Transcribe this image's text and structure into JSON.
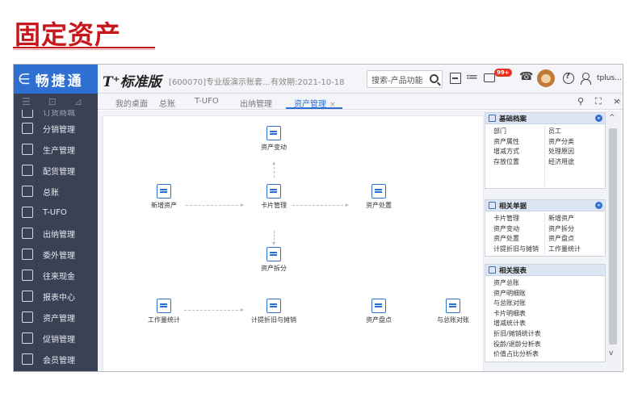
{
  "banner": {
    "title": "固定资产"
  },
  "app": {
    "logo_arrow": "∈",
    "logo_text": "畅捷通",
    "product_name": "T⁺标准版",
    "account_info": "[600070]专业版演示账套...",
    "expiry": "有效期:2021-10-18",
    "search_placeholder": "搜索-产品功能",
    "badge": "99+",
    "username": "tplus..."
  },
  "sidebar": {
    "toolbar_icons": [
      "menu-icon",
      "home-icon",
      "pin-icon"
    ],
    "items": [
      {
        "label": "订货商城",
        "icon": "shop-icon"
      },
      {
        "label": "分销管理",
        "icon": "network-icon"
      },
      {
        "label": "生产管理",
        "icon": "factory-icon"
      },
      {
        "label": "配货管理",
        "icon": "delivery-icon"
      },
      {
        "label": "总账",
        "icon": "ledger-icon"
      },
      {
        "label": "T-UFO",
        "icon": "ufo-icon"
      },
      {
        "label": "出纳管理",
        "icon": "cashier-icon"
      },
      {
        "label": "委外管理",
        "icon": "outsource-icon"
      },
      {
        "label": "往来现金",
        "icon": "exchange-icon"
      },
      {
        "label": "报表中心",
        "icon": "report-icon"
      },
      {
        "label": "资产管理",
        "icon": "bank-icon"
      },
      {
        "label": "促销管理",
        "icon": "megaphone-icon"
      },
      {
        "label": "会员管理",
        "icon": "member-icon"
      }
    ]
  },
  "tabs": [
    {
      "label": "我的桌面"
    },
    {
      "label": "总账"
    },
    {
      "label": "T-UFO"
    },
    {
      "label": "出纳管理"
    },
    {
      "label": "资产管理",
      "active": true
    }
  ],
  "tab_close": "×",
  "window_controls": {
    "search": "⚲",
    "maximize": "⛶",
    "close": "×",
    "scroll_up": "^"
  },
  "flow": {
    "asset_change": "资产变动",
    "new_asset": "新增资产",
    "card_manage": "卡片管理",
    "asset_disposal": "资产处置",
    "asset_split": "资产拆分",
    "workload_stats": "工作量统计",
    "depreciation": "计提折旧与摊销",
    "asset_inventory": "资产盘点",
    "gl_reconcile": "与总账对账"
  },
  "panels": {
    "basic": {
      "title": "基础档案",
      "col1": [
        "部门",
        "资产属性",
        "增减方式",
        "存放位置"
      ],
      "col2": [
        "员工",
        "资产分类",
        "处理原因",
        "经济用途"
      ]
    },
    "docs": {
      "title": "相关单据",
      "col1": [
        "卡片管理",
        "资产变动",
        "资产处置",
        "计提折旧与摊销"
      ],
      "col2": [
        "新增资产",
        "资产拆分",
        "资产盘点",
        "工作量统计"
      ]
    },
    "reports": {
      "title": "相关报表",
      "items": [
        "资产总账",
        "资产明细账",
        "与总账对账",
        "卡片明细表",
        "增减统计表",
        "折旧/摊销统计表",
        "役龄/退龄分析表",
        "价值占比分析表"
      ]
    }
  }
}
